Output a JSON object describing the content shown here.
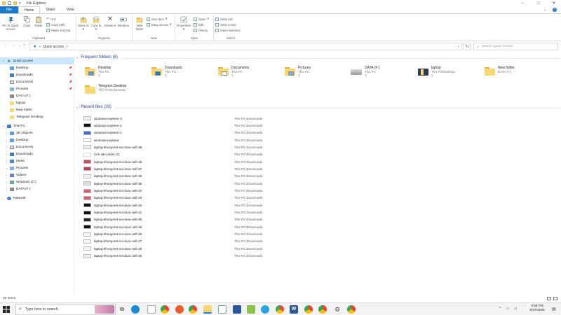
{
  "window": {
    "title": "File Explorer",
    "controls": {
      "minimize": "–",
      "maximize": "□",
      "close": "✕"
    }
  },
  "ribbon_tabs": [
    "File",
    "Home",
    "Share",
    "View"
  ],
  "ribbon": {
    "clipboard": {
      "pin": "Pin to Quick access",
      "copy": "Copy",
      "paste": "Paste",
      "cut": "Cut",
      "copy_path": "Copy path",
      "paste_shortcut": "Paste shortcut",
      "group": "Clipboard"
    },
    "organize": {
      "move_to": "Move to",
      "copy_to": "Copy to",
      "delete": "Delete",
      "rename": "Rename",
      "group": "Organize"
    },
    "new": {
      "new_folder": "New folder",
      "new_item": "New item",
      "easy_access": "Easy access",
      "group": "New"
    },
    "open": {
      "properties": "Properties",
      "open": "Open",
      "edit": "Edit",
      "history": "History",
      "group": "Open"
    },
    "select": {
      "select_all": "Select all",
      "select_none": "Select none",
      "invert": "Invert selection",
      "group": "Select"
    }
  },
  "address": {
    "path": "Quick access",
    "separator": ">",
    "search_placeholder": "Search Quick access"
  },
  "nav": {
    "quick_access": "Quick access",
    "pinned": [
      "Desktop",
      "Downloads",
      "Documents",
      "Pictures"
    ],
    "unpinned": [
      "DATA (F:)",
      "laptop",
      "New folder",
      "Telegram Desktop"
    ],
    "this_pc": "This PC",
    "pc_items": [
      "3D Objects",
      "Desktop",
      "Documents",
      "Downloads",
      "Music",
      "Pictures",
      "Videos",
      "Windows (C:)",
      "DATA (F:)"
    ],
    "network": "Network"
  },
  "frequent": {
    "header": "Frequent folders (8)",
    "items": [
      {
        "name": "Desktop",
        "sub": "This PC"
      },
      {
        "name": "Downloads",
        "sub": "This PC"
      },
      {
        "name": "Documents",
        "sub": "This PC"
      },
      {
        "name": "Pictures",
        "sub": "This PC"
      },
      {
        "name": "DATA (F:)",
        "sub": "This PC"
      },
      {
        "name": "laptop",
        "sub": "This PC\\Desktop"
      },
      {
        "name": "New folder",
        "sub": "DATA (F:)"
      },
      {
        "name": "Telegram Desktop",
        "sub": "This PC\\Downloads"
      }
    ]
  },
  "recent": {
    "header": "Recent files (20)",
    "files": [
      {
        "name": "windows-explorer-3",
        "path": "This PC\\Downloads"
      },
      {
        "name": "windows-explorer-2",
        "path": "This PC\\Downloads"
      },
      {
        "name": "windows-explorer-1",
        "path": "This PC\\Downloads"
      },
      {
        "name": "windows-explorer",
        "path": "This PC\\Downloads"
      },
      {
        "name": "laptop-khong-ket-noi-duoc-wifi-38",
        "path": "This PC\\Downloads"
      },
      {
        "name": "Ảnh sản phẩm (7)",
        "path": "This PC\\Downloads"
      },
      {
        "name": "laptop-khong-ket-noi-duoc-wifi-38",
        "path": "This PC\\Downloads"
      },
      {
        "name": "laptop-khong-ket-noi-duoc-wifi-37",
        "path": "This PC\\Downloads"
      },
      {
        "name": "laptop-khong-ket-noi-duoc-wifi-36",
        "path": "This PC\\Downloads"
      },
      {
        "name": "laptop-khong-ket-noi-duoc-wifi-35",
        "path": "This PC\\Downloads"
      },
      {
        "name": "laptop-khong-ket-noi-duoc-wifi-34",
        "path": "This PC\\Downloads"
      },
      {
        "name": "laptop-khong-ket-noi-duoc-wifi-33",
        "path": "This PC\\Downloads"
      },
      {
        "name": "laptop-khong-ket-noi-duoc-wifi-32",
        "path": "This PC\\Downloads"
      },
      {
        "name": "laptop-khong-ket-noi-duoc-wifi-31",
        "path": "This PC\\Downloads"
      },
      {
        "name": "laptop-khong-ket-noi-duoc-wifi-30",
        "path": "This PC\\Downloads"
      },
      {
        "name": "laptop-khong-ket-noi-duoc-wifi-29",
        "path": "This PC\\Downloads"
      },
      {
        "name": "laptop-khong-ket-noi-duoc-wifi-28",
        "path": "This PC\\Downloads"
      },
      {
        "name": "laptop-khong-ket-noi-duoc-wifi-27",
        "path": "This PC\\Downloads"
      },
      {
        "name": "laptop-khong-ket-noi-duoc-wifi-26",
        "path": "This PC\\Downloads"
      },
      {
        "name": "laptop-khong-ket-noi-duoc-wifi-25",
        "path": "This PC\\Downloads"
      }
    ]
  },
  "status": {
    "items": "28 items"
  },
  "taskbar": {
    "search_placeholder": "Type here to search",
    "time": "3:56 PM",
    "date": "6/27/2026"
  },
  "colors": {
    "accent": "#1979ca",
    "folder": "#f8d775",
    "selected": "#cce8ff"
  }
}
